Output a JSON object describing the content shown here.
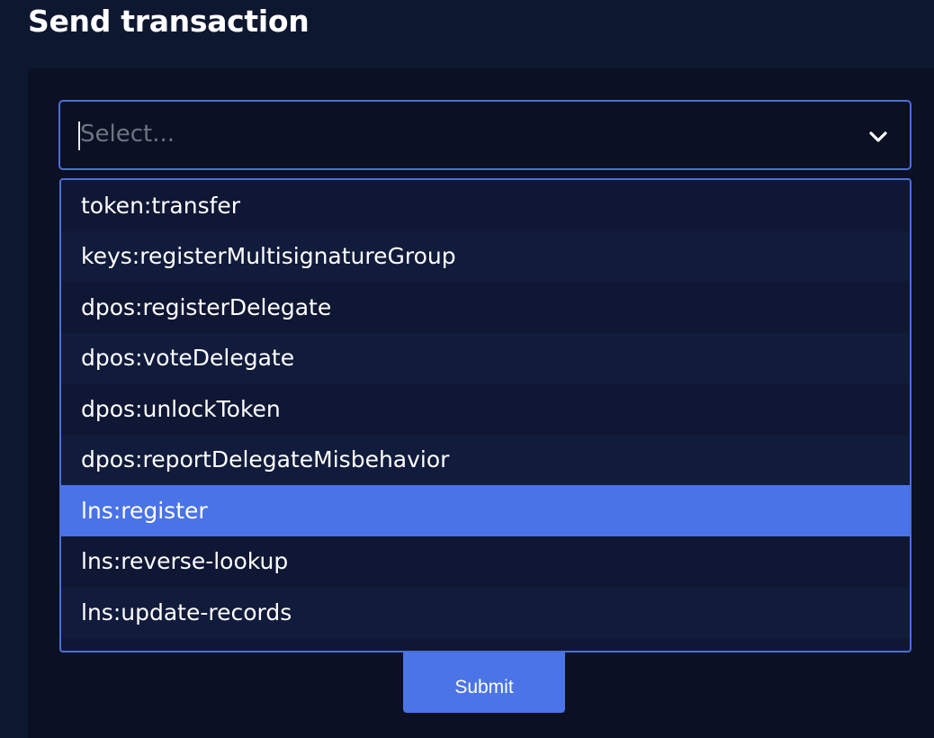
{
  "page": {
    "title": "Send transaction"
  },
  "select": {
    "placeholder": "Select...",
    "chevron_icon": "chevron-down-icon"
  },
  "options": [
    {
      "label": "token:transfer"
    },
    {
      "label": "keys:registerMultisignatureGroup"
    },
    {
      "label": "dpos:registerDelegate"
    },
    {
      "label": "dpos:voteDelegate"
    },
    {
      "label": "dpos:unlockToken"
    },
    {
      "label": "dpos:reportDelegateMisbehavior"
    },
    {
      "label": "lns:register",
      "highlighted": true
    },
    {
      "label": "lns:reverse-lookup"
    },
    {
      "label": "lns:update-records"
    }
  ],
  "submit": {
    "label": "Submit"
  },
  "colors": {
    "background": "#0e1730",
    "card": "#0b1022",
    "accent": "#4a73e8",
    "border": "#4a70d8"
  }
}
